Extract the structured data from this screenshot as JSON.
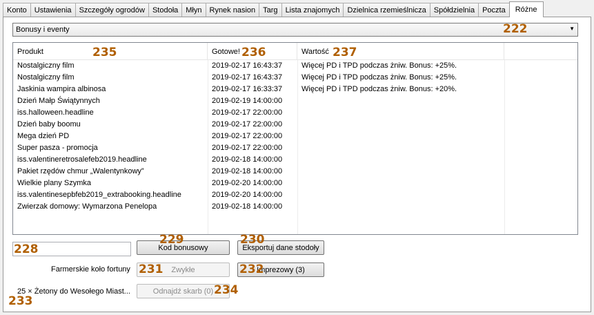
{
  "tabs": [
    "Konto",
    "Ustawienia",
    "Szczegóły ogrodów",
    "Stodoła",
    "Młyn",
    "Rynek nasion",
    "Targ",
    "Lista znajomych",
    "Dzielnica rzemieślnicza",
    "Spółdzielnia",
    "Poczta",
    "Różne"
  ],
  "active_tab": "Różne",
  "combo": {
    "value": "Bonusy i eventy"
  },
  "table": {
    "headers": [
      "Produkt",
      "Gotowe!",
      "Wartość"
    ],
    "rows": [
      [
        "Nostalgiczny film",
        "2019-02-17 16:43:37",
        "Więcej PD i TPD podczas żniw. Bonus: +25%."
      ],
      [
        "Nostalgiczny film",
        "2019-02-17 16:43:37",
        "Więcej PD i TPD podczas żniw. Bonus: +25%."
      ],
      [
        "Jaskinia wampira albinosa",
        "2019-02-17 16:33:37",
        "Więcej PD i TPD podczas żniw. Bonus: +20%."
      ],
      [
        "Dzień Małp Świątynnych",
        "2019-02-19 14:00:00",
        ""
      ],
      [
        "iss.halloween.headline",
        "2019-02-17 22:00:00",
        ""
      ],
      [
        "Dzień baby boomu",
        "2019-02-17 22:00:00",
        ""
      ],
      [
        "Mega dzień PD",
        "2019-02-17 22:00:00",
        ""
      ],
      [
        "Super pasza - promocja",
        "2019-02-17 22:00:00",
        ""
      ],
      [
        "iss.valentineretrosalefeb2019.headline",
        "2019-02-18 14:00:00",
        ""
      ],
      [
        "Pakiet rzędów chmur „Walentynkowy”",
        "2019-02-18 14:00:00",
        ""
      ],
      [
        "Wielkie plany Szymka",
        "2019-02-20 14:00:00",
        ""
      ],
      [
        "iss.valentinesepbfeb2019_extrabooking.headline",
        "2019-02-20 14:00:00",
        ""
      ],
      [
        "Zwierzak domowy: Wymarzona Penelopa",
        "2019-02-18 14:00:00",
        ""
      ]
    ]
  },
  "buttons": {
    "bonus_code": "Kod bonusowy",
    "export_barn": "Eksportuj dane stodoły",
    "ordinary": "Zwykłe",
    "party": "Imprezowy (3)",
    "find_treasure": "Odnajdź skarb (0)"
  },
  "labels": {
    "wheel": "Farmerskie koło fortuny",
    "tokens": "25 × Żetony do Wesołego Miast..."
  },
  "annotations": {
    "a222": "222",
    "a235": "235",
    "a236": "236",
    "a237": "237",
    "a228": "228",
    "a229": "229",
    "a230": "230",
    "a231": "231",
    "a232": "232",
    "a233": "233",
    "a234": "234"
  },
  "colors": {
    "annotation": "#b05f00"
  }
}
